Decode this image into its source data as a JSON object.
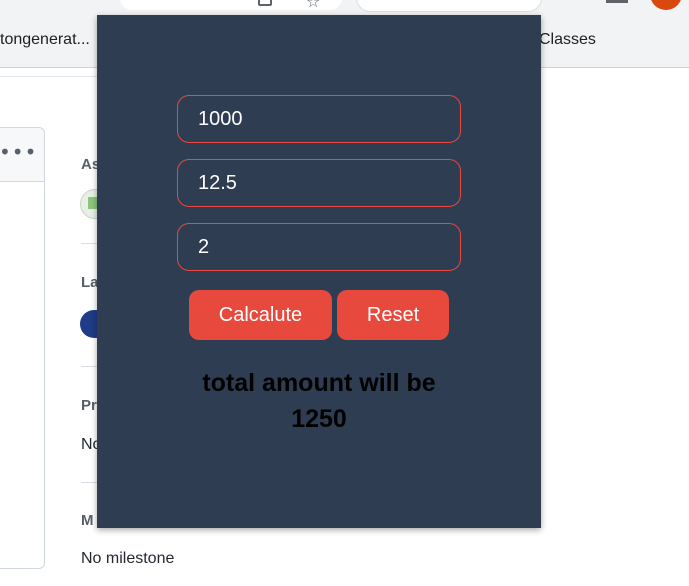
{
  "browser": {
    "bookmarks": [
      "tongenerat...",
      "Classes"
    ],
    "profile_color": "#d9480f"
  },
  "background_page": {
    "labels": {
      "assignees_partial": "As",
      "labels_partial": "La",
      "projects_partial": "Pr",
      "projects_value_partial": "No",
      "milestone_partial": "M",
      "milestone_value": "No milestone"
    }
  },
  "popup": {
    "background": "#2e3d51",
    "accent": "#e8493d",
    "inputs": {
      "principal": "1000",
      "rate": "12.5",
      "years": "2"
    },
    "buttons": {
      "calculate": "Calcalute",
      "reset": "Reset"
    },
    "result": {
      "line1": "total amount will be",
      "line2": "1250"
    }
  }
}
